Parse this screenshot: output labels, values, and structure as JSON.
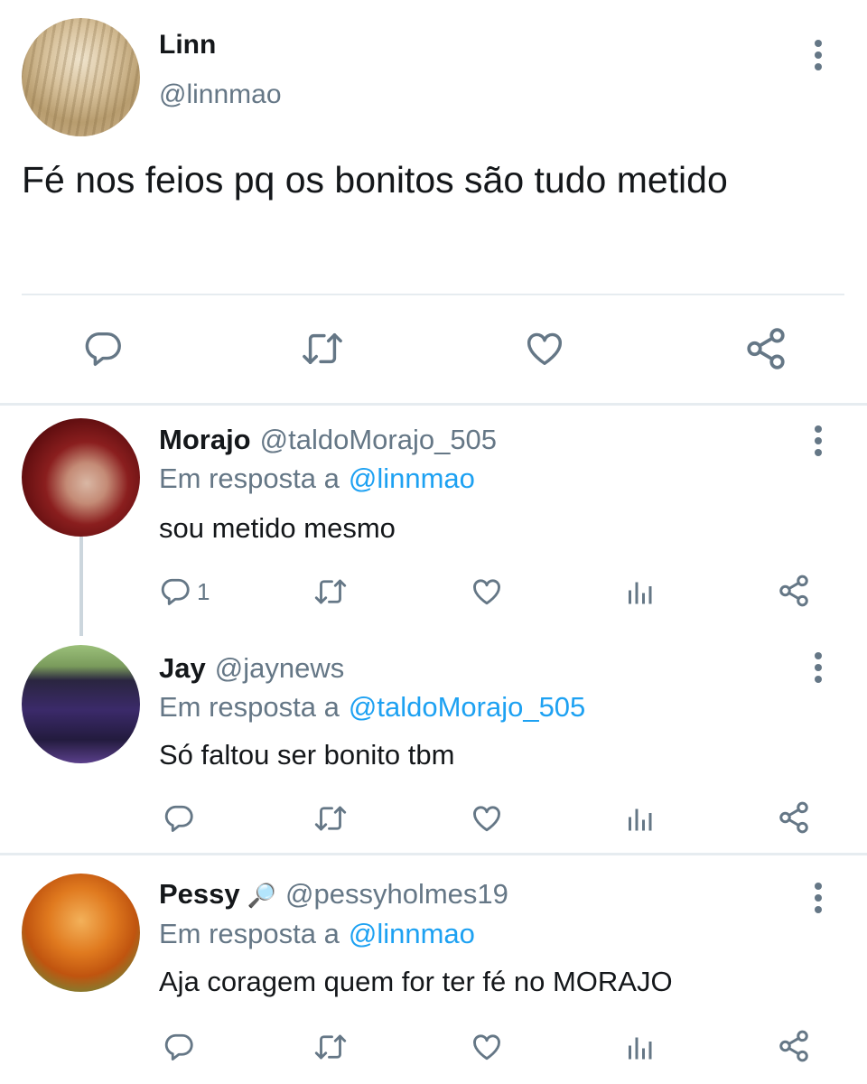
{
  "main_tweet": {
    "name": "Linn",
    "handle": "@linnmao",
    "text": "Fé nos feios pq os bonitos são tudo metido"
  },
  "replies": [
    {
      "name": "Morajo",
      "handle": "@taldoMorajo_505",
      "emoji": "",
      "in_reply_prefix": "Em resposta a",
      "in_reply_to": "@linnmao",
      "text": "sou metido mesmo",
      "reply_count": "1"
    },
    {
      "name": "Jay",
      "handle": "@jaynews",
      "emoji": "",
      "in_reply_prefix": "Em resposta a",
      "in_reply_to": "@taldoMorajo_505",
      "text": "Só faltou ser bonito tbm",
      "reply_count": ""
    },
    {
      "name": "Pessy",
      "handle": "@pessyholmes19",
      "emoji": "🔎",
      "in_reply_prefix": "Em resposta a",
      "in_reply_to": "@linnmao",
      "text": "Aja coragem quem for ter fé no MORAJO",
      "reply_count": ""
    }
  ],
  "icons": [
    "reply-icon",
    "retweet-icon",
    "like-icon",
    "share-icon",
    "analytics-icon",
    "more-options-icon"
  ],
  "colors": {
    "text": "#14171a",
    "secondary": "#657786",
    "link": "#1da1f2",
    "divider": "#e6ecf0",
    "icon": "#657786"
  }
}
